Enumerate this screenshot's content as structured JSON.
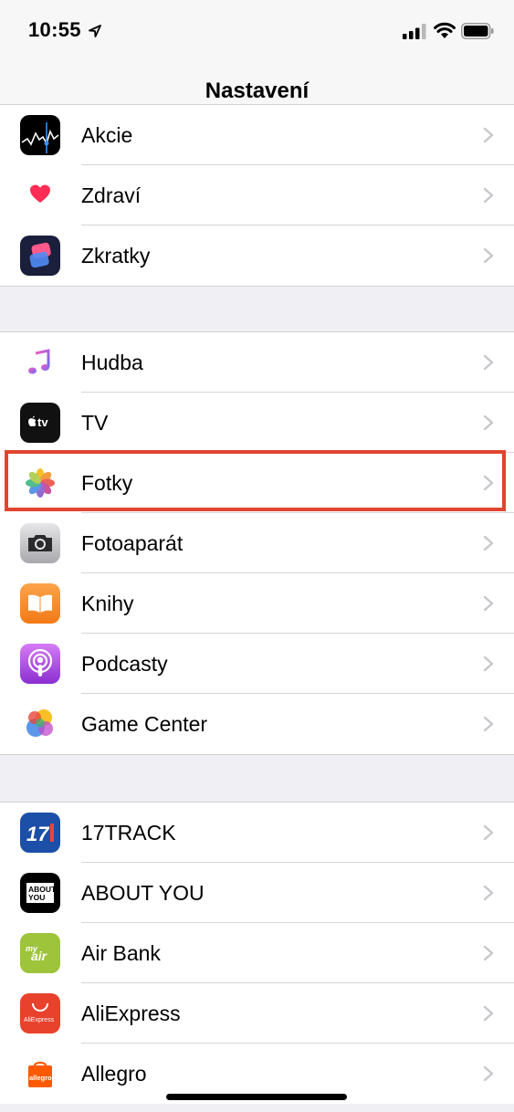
{
  "status_bar": {
    "time": "10:55"
  },
  "nav": {
    "title": "Nastavení"
  },
  "groups": [
    {
      "items": [
        {
          "label": "Akcie",
          "icon": "stocks-icon"
        },
        {
          "label": "Zdraví",
          "icon": "health-icon"
        },
        {
          "label": "Zkratky",
          "icon": "shortcuts-icon"
        }
      ]
    },
    {
      "items": [
        {
          "label": "Hudba",
          "icon": "music-icon"
        },
        {
          "label": "TV",
          "icon": "apple-tv-icon",
          "icon_text": "tv"
        },
        {
          "label": "Fotky",
          "icon": "photos-icon",
          "highlighted": true
        },
        {
          "label": "Fotoaparát",
          "icon": "camera-icon"
        },
        {
          "label": "Knihy",
          "icon": "books-icon"
        },
        {
          "label": "Podcasty",
          "icon": "podcasts-icon"
        },
        {
          "label": "Game Center",
          "icon": "game-center-icon"
        }
      ]
    },
    {
      "items": [
        {
          "label": "17TRACK",
          "icon": "17track-icon",
          "icon_text": "17"
        },
        {
          "label": "ABOUT YOU",
          "icon": "about-you-icon",
          "icon_text_1": "ABOUT",
          "icon_text_2": "YOU"
        },
        {
          "label": "Air Bank",
          "icon": "air-bank-icon",
          "icon_text_1": "my",
          "icon_text_2": "air"
        },
        {
          "label": "AliExpress",
          "icon": "aliexpress-icon",
          "icon_text": "AliExpress"
        },
        {
          "label": "Allegro",
          "icon": "allegro-icon",
          "icon_text": "allegro"
        }
      ]
    }
  ],
  "colors": {
    "highlight": "#e2442f",
    "chevron": "#c7c7cc",
    "background": "#efeff4"
  }
}
